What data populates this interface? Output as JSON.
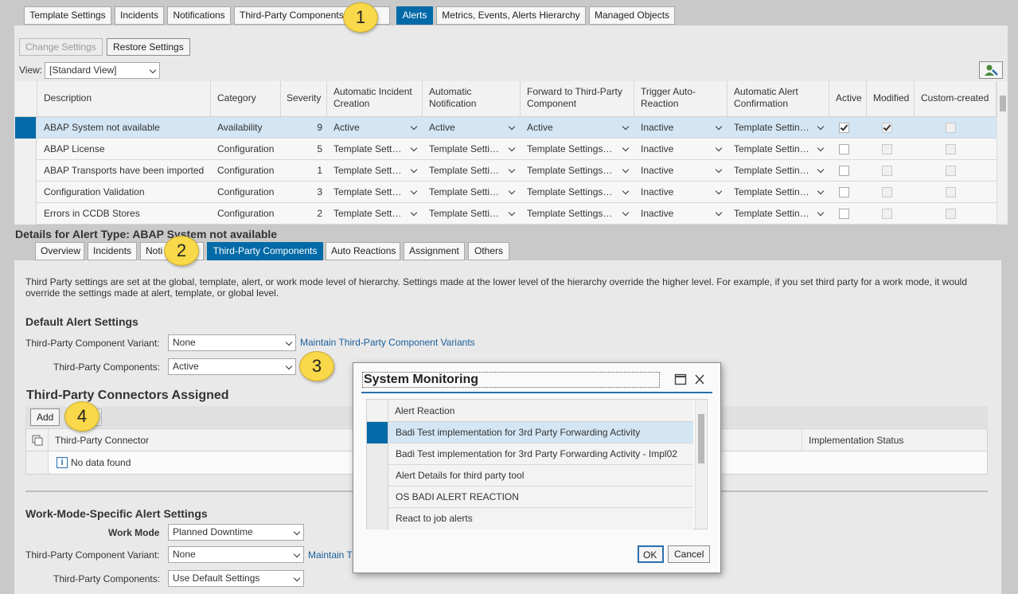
{
  "top_tabs": [
    {
      "label": "Template Settings"
    },
    {
      "label": "Incidents"
    },
    {
      "label": "Notifications"
    },
    {
      "label": "Third-Party Components"
    },
    {
      "label": "Alerts"
    },
    {
      "label": "Metrics, Events, Alerts Hierarchy"
    },
    {
      "label": "Managed Objects"
    }
  ],
  "toolbar": {
    "change_settings": "Change Settings",
    "restore_settings": "Restore Settings"
  },
  "view": {
    "label": "View:",
    "value": "[Standard View]"
  },
  "alerts_table": {
    "columns": [
      "Description",
      "Category",
      "Severity",
      "Automatic Incident Creation",
      "Automatic Notification",
      "Forward to Third-Party Component",
      "Trigger Auto-Reaction",
      "Automatic Alert Confirmation",
      "Active",
      "Modified",
      "Custom-created"
    ],
    "rows": [
      {
        "description": "ABAP System not available",
        "category": "Availability",
        "severity": "9",
        "incident": "Active",
        "notification": "Active",
        "forward": "Active",
        "trigger": "Inactive",
        "confirmation": "Template Settin…"
      },
      {
        "description": "ABAP License",
        "category": "Configuration",
        "severity": "5",
        "incident": "Template Sett…",
        "notification": "Template Setti…",
        "forward": "Template Settings…",
        "trigger": "Inactive",
        "confirmation": "Template Settin…"
      },
      {
        "description": "ABAP Transports have been imported",
        "category": "Configuration",
        "severity": "1",
        "incident": "Template Sett…",
        "notification": "Template Setti…",
        "forward": "Template Settings…",
        "trigger": "Inactive",
        "confirmation": "Template Settin…"
      },
      {
        "description": "Configuration Validation",
        "category": "Configuration",
        "severity": "3",
        "incident": "Template Sett…",
        "notification": "Template Setti…",
        "forward": "Template Settings…",
        "trigger": "Inactive",
        "confirmation": "Template Settin…"
      },
      {
        "description": "Errors in CCDB Stores",
        "category": "Configuration",
        "severity": "2",
        "incident": "Template Sett…",
        "notification": "Template Setti…",
        "forward": "Template Settings…",
        "trigger": "Inactive",
        "confirmation": "Template Settin…"
      }
    ]
  },
  "details": {
    "title": "Details for Alert Type: ABAP System not available",
    "tabs": [
      {
        "label": "Overview"
      },
      {
        "label": "Incidents"
      },
      {
        "label": "Noti"
      },
      {
        "label": "Third-Party Components"
      },
      {
        "label": "Auto Reactions"
      },
      {
        "label": "Assignment"
      },
      {
        "label": "Others"
      }
    ],
    "info_text": "Third Party settings are set at the global, template, alert, or work mode level of hierarchy. Settings made at the lower level of the hierarchy override the higher level. For example, if you set third party for a work mode, it would override the settings made at alert, template, or global level.",
    "default_title": "Default Alert Settings",
    "variant_label": "Third-Party Component Variant:",
    "variant_value": "None",
    "maintain_link": "Maintain Third-Party Component Variants",
    "components_label": "Third-Party Components:",
    "components_value": "Active",
    "connectors_title": "Third-Party Connectors Assigned",
    "add_button": "Add",
    "col_connector": "Third-Party Connector",
    "col_status": "Implementation Status",
    "no_data": "No data found",
    "workmode_title": "Work-Mode-Specific Alert Settings",
    "workmode_label": "Work Mode",
    "workmode_value": "Planned Downtime",
    "wm_variant_label": "Third-Party Component Variant:",
    "wm_variant_value": "None",
    "wm_maintain_link": "Maintain T",
    "wm_components_label": "Third-Party Components:",
    "wm_components_value": "Use Default Settings"
  },
  "dialog": {
    "title": "System Monitoring",
    "column": "Alert Reaction",
    "items": [
      "Badi Test implementation for 3rd Party Forwarding Activity",
      "Badi Test implementation for 3rd Party Forwarding Activity - Impl02",
      "Alert Details for third party tool",
      "OS BADI ALERT REACTION",
      "React to job alerts"
    ],
    "ok": "OK",
    "cancel": "Cancel"
  },
  "callouts": [
    "1",
    "2",
    "3",
    "4"
  ],
  "colors": {
    "accent": "#036aa8",
    "callout": "#f9d84a"
  }
}
